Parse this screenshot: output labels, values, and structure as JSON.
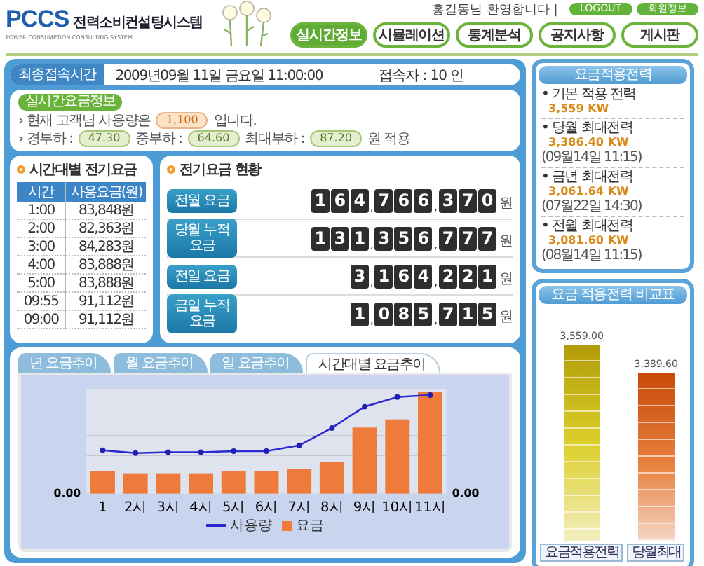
{
  "header": {
    "logo": "PCCS",
    "system_name": "전력소비컨설팅시스템",
    "subtitle": "POWER CONSUMPTION CONSULTING SYSTEM",
    "welcome": "홍길동님 환영합니다 |",
    "account_buttons": [
      "LOGOUT",
      "회원정보"
    ]
  },
  "nav": [
    {
      "label": "실시간정보",
      "selected": true
    },
    {
      "label": "시뮬레이션",
      "selected": false
    },
    {
      "label": "통계분석",
      "selected": false
    },
    {
      "label": "공지사항",
      "selected": false
    },
    {
      "label": "게시판",
      "selected": false
    }
  ],
  "access_bar": {
    "label": "최종접속시간",
    "datetime": "2009년09월 11일 금요일 11:00:00",
    "visitors": "접속자 : 10 인"
  },
  "notice": {
    "badge": "실시간요금정보",
    "line1": {
      "before": "› 현재 고객님 사용량은",
      "value": "1,100",
      "after": "입니다."
    },
    "line2": {
      "parts": [
        {
          "label": "› 경부하 :",
          "value": "47.30"
        },
        {
          "label": "중부하 :",
          "value": "64.60"
        },
        {
          "label": "최대부하 :",
          "value": "87.20"
        }
      ],
      "after": "원 적용"
    }
  },
  "hourly_table": {
    "title": "시간대별 전기요금",
    "columns": [
      "시간",
      "사용요금(원)"
    ],
    "rows": [
      [
        "1:00",
        "83,848원"
      ],
      [
        "2:00",
        "82,363원"
      ],
      [
        "3:00",
        "84,283원"
      ],
      [
        "4:00",
        "83,888원"
      ],
      [
        "5:00",
        "83,888원"
      ],
      [
        "09:55",
        "91,112원"
      ],
      [
        "09:00",
        "91,112원"
      ]
    ]
  },
  "fee_status": {
    "title": "전기요금 현황",
    "rows": [
      {
        "label": "전월 요금",
        "tiles": [
          {
            "kind": "digit",
            "text": "1"
          },
          {
            "kind": "digit",
            "text": "6"
          },
          {
            "kind": "digit",
            "text": "4"
          },
          {
            "kind": "separator",
            "text": ","
          },
          {
            "kind": "digit",
            "text": "7"
          },
          {
            "kind": "digit",
            "text": "6"
          },
          {
            "kind": "digit",
            "text": "6"
          },
          {
            "kind": "separator",
            "text": ","
          },
          {
            "kind": "digit",
            "text": "3"
          },
          {
            "kind": "digit",
            "text": "7"
          },
          {
            "kind": "digit",
            "text": "0"
          }
        ],
        "unit": "원"
      },
      {
        "label": "당월 누적 요금",
        "tiles": [
          {
            "kind": "digit",
            "text": "1"
          },
          {
            "kind": "digit",
            "text": "3"
          },
          {
            "kind": "digit",
            "text": "1"
          },
          {
            "kind": "separator",
            "text": ","
          },
          {
            "kind": "digit",
            "text": "3"
          },
          {
            "kind": "digit",
            "text": "5"
          },
          {
            "kind": "digit",
            "text": "6"
          },
          {
            "kind": "separator",
            "text": ","
          },
          {
            "kind": "digit",
            "text": "7"
          },
          {
            "kind": "digit",
            "text": "7"
          },
          {
            "kind": "digit",
            "text": "7"
          }
        ],
        "unit": "원"
      },
      {
        "label": "전일 요금",
        "tiles": [
          {
            "kind": "digit",
            "text": "3"
          },
          {
            "kind": "separator",
            "text": ","
          },
          {
            "kind": "digit",
            "text": "1"
          },
          {
            "kind": "digit",
            "text": "6"
          },
          {
            "kind": "digit",
            "text": "4"
          },
          {
            "kind": "separator",
            "text": ","
          },
          {
            "kind": "digit",
            "text": "2"
          },
          {
            "kind": "digit",
            "text": "2"
          },
          {
            "kind": "digit",
            "text": "1"
          }
        ],
        "unit": "원"
      },
      {
        "label": "금일 누적 요금",
        "tiles": [
          {
            "kind": "digit",
            "text": "1"
          },
          {
            "kind": "separator",
            "text": ","
          },
          {
            "kind": "digit",
            "text": "0"
          },
          {
            "kind": "digit",
            "text": "8"
          },
          {
            "kind": "digit",
            "text": "5"
          },
          {
            "kind": "separator",
            "text": ","
          },
          {
            "kind": "digit",
            "text": "7"
          },
          {
            "kind": "digit",
            "text": "1"
          },
          {
            "kind": "digit",
            "text": "5"
          }
        ],
        "unit": "원"
      }
    ]
  },
  "chart_tabs": [
    {
      "label": "년 요금추이",
      "selected": false
    },
    {
      "label": "월 요금추이",
      "selected": false
    },
    {
      "label": "일 요금추이",
      "selected": false
    },
    {
      "label": "시간대별 요금추이",
      "selected": true
    }
  ],
  "chart": {
    "x_labels": [
      "1",
      "2시",
      "3시",
      "4시",
      "5시",
      "6시",
      "7시",
      "8시",
      "9시",
      "10시",
      "11시"
    ],
    "left_zero": "0.00",
    "right_zero": "0.00",
    "legend": [
      "사용량",
      "요금"
    ]
  },
  "applied_power": {
    "title": "요금적용전력",
    "items": [
      {
        "label": "• 기본 적용 전력",
        "value": "3,559 KW"
      },
      {
        "label": "• 당월 최대전력",
        "value": "3,386.40 KW",
        "note": "(09월14일 11:15)"
      },
      {
        "label": "• 금년 최대전력",
        "value": "3,061.64 KW",
        "note": "(07월22일 14:30)"
      },
      {
        "label": "• 전월 최대전력",
        "value": "3,081.60 KW",
        "note": "(08월14일 11:15)"
      }
    ]
  },
  "comparison": {
    "title": "요금 적용전력 비교표",
    "bars": [
      {
        "value": "3,559.00",
        "button": "요금적용전력"
      },
      {
        "value": "3,389.60",
        "button": "당월최대"
      }
    ]
  }
}
